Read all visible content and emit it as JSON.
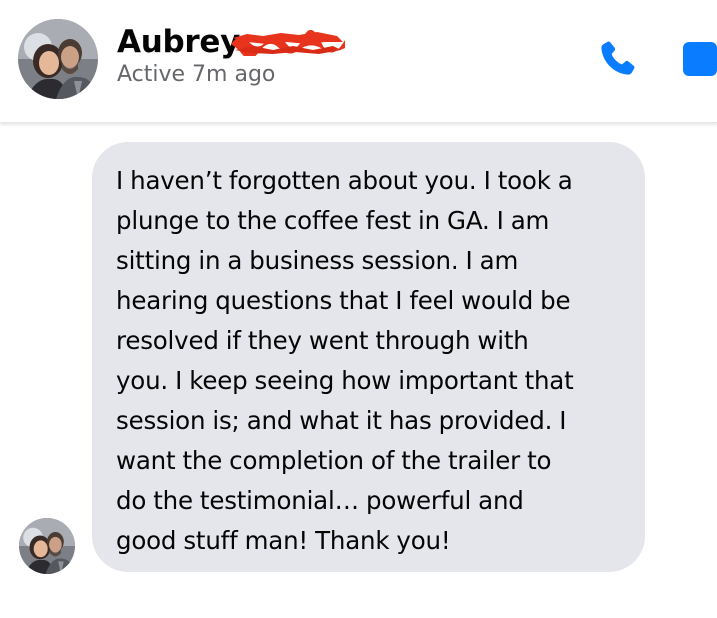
{
  "conversation": {
    "contact": {
      "name": "Aubrey",
      "status": "Active 7m ago",
      "avatar_icon": "profile-photo-couple"
    },
    "actions": {
      "call_icon": "phone-icon",
      "video_icon": "video-icon"
    },
    "accent_color": "#0a7cff",
    "redaction_color": "#e8341c"
  },
  "messages": [
    {
      "sender": "Aubrey",
      "lines": [
        "I haven’t forgotten about you. I took a",
        "plunge to the coffee fest in GA. I am",
        "sitting in a business session. I am",
        "hearing questions that I feel would be",
        "resolved if they went through with",
        "you. I keep seeing how important that",
        "session is; and what it has provided. I",
        "want the completion of the trailer to",
        "do the testimonial… powerful and",
        "good stuff man! Thank you!"
      ]
    }
  ]
}
